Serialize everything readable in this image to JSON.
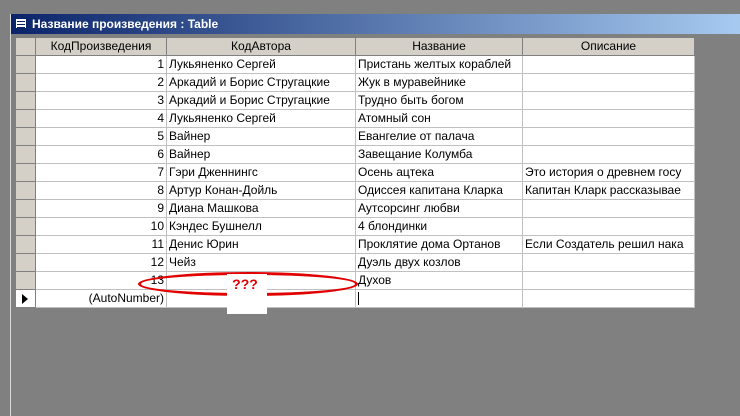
{
  "window": {
    "title": "Название произведения : Table"
  },
  "columns": [
    "КодПроизведения",
    "КодАвтора",
    "Название",
    "Описание"
  ],
  "rows": [
    [
      "1",
      "Лукьяненко Сергей",
      "Пристань желтых кораблей",
      ""
    ],
    [
      "2",
      "Аркадий и Борис Стругацкие",
      "Жук в муравейнике",
      ""
    ],
    [
      "3",
      "Аркадий и Борис Стругацкие",
      "Трудно быть богом",
      ""
    ],
    [
      "4",
      "Лукьяненко Сергей",
      "Атомный сон",
      ""
    ],
    [
      "5",
      "Вайнер",
      "Евангелие от палача",
      ""
    ],
    [
      "6",
      "Вайнер",
      "Завещание Колумба",
      ""
    ],
    [
      "7",
      "Гэри Дженнингс",
      "Осень ацтека",
      "Это история о древнем госу"
    ],
    [
      "8",
      "Артур Конан-Дойль",
      "Одиссея капитана Кларка",
      "Капитан Кларк рассказывае"
    ],
    [
      "9",
      "Диана Машкова",
      "Аутсорсинг любви",
      ""
    ],
    [
      "10",
      "Кэндес Бушнелл",
      "4 блондинки",
      ""
    ],
    [
      "11",
      "Денис Юрин",
      "Проклятие дома Ортанов",
      "Если Создатель решил нака"
    ],
    [
      "12",
      "Чейз",
      "Дуэль двух козлов",
      ""
    ],
    [
      "13",
      "",
      "Духов",
      ""
    ]
  ],
  "new_row": {
    "id": "(AutoNumber)"
  },
  "annotation": {
    "text": "???",
    "color": "#e00000"
  },
  "colors": {
    "titlebar_start": "#0a246a",
    "titlebar_end": "#a6caf0",
    "background": "#808080"
  }
}
